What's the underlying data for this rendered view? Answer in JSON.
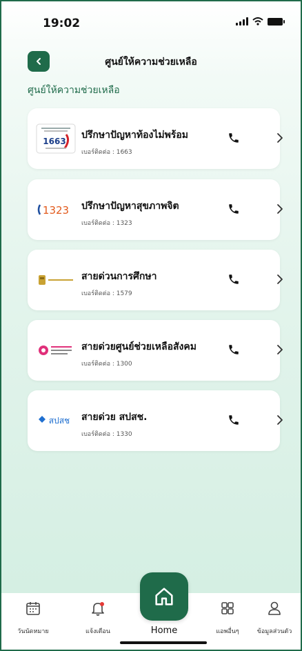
{
  "status_bar": {
    "time": "19:02"
  },
  "header": {
    "title": "ศูนย์ให้ความช่วยเหลือ"
  },
  "section": {
    "title": "ศูนย์ให้ความช่วยเหลือ"
  },
  "cards": [
    {
      "name": "ปรึกษาปัญหาท้องไม่พร้อม",
      "phone_label": "เบอร์ติดต่อ : 1663",
      "logo_text": "1663"
    },
    {
      "name": "ปรึกษาปัญหาสุขภาพจิต",
      "phone_label": "เบอร์ติดต่อ : 1323",
      "logo_text": "1323"
    },
    {
      "name": "สายด่วนการศึกษา",
      "phone_label": "เบอร์ติดต่อ : 1579"
    },
    {
      "name": "สายด่วยศูนย์ช่วยเหลือสังคม",
      "phone_label": "เบอร์ติดต่อ : 1300"
    },
    {
      "name": "สายด่วย สปสช.",
      "phone_label": "เบอร์ติดต่อ : 1330",
      "logo_text": "สปสช"
    }
  ],
  "bottom_nav": {
    "appointments": "วันนัดหมาย",
    "notifications": "แจ้งเตือน",
    "home": "Home",
    "other_apps": "แอพอื่นๆ",
    "profile": "ข้อมูลส่วนตัว"
  },
  "colors": {
    "brand_green": "#1f6b4a",
    "background_mint": "#d2eee1"
  }
}
